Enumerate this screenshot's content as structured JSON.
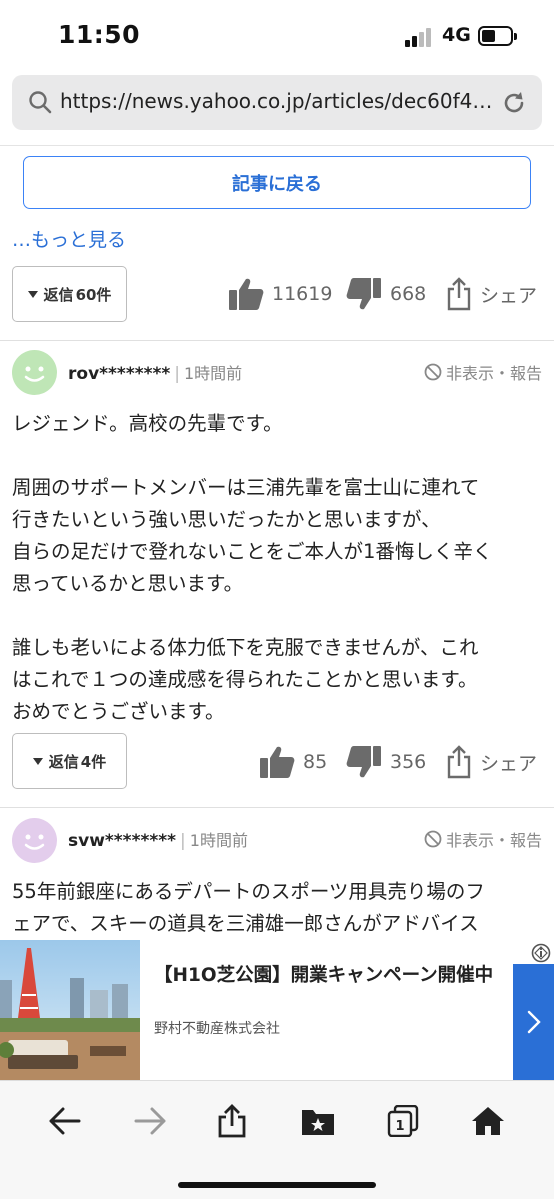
{
  "status_bar": {
    "time": "11:50",
    "network": "4G"
  },
  "browser": {
    "url": "https://news.yahoo.co.jp/articles/dec60f4b..."
  },
  "article": {
    "back_label": "記事に戻る",
    "more_label": "…もっと見る"
  },
  "top_comment": {
    "reply_label": "返信",
    "reply_count": "60件",
    "likes": "11619",
    "dislikes": "668",
    "share_label": "シェア"
  },
  "comments": [
    {
      "user": "rov********",
      "time": "1時間前",
      "hide_report": "非表示・報告",
      "avatar_color": "#bfe6b6",
      "lines": [
        "レジェンド。高校の先輩です。",
        "",
        "周囲のサポートメンバーは三浦先輩を富士山に連れて",
        "行きたいという強い思いだったかと思いますが、",
        "自らの足だけで登れないことをご本人が1番悔しく辛く",
        "思っているかと思います。",
        "",
        "誰しも老いによる体力低下を克服できませんが、これ",
        "はこれで１つの達成感を得られたことかと思います。",
        "おめでとうございます。"
      ],
      "reply_label": "返信",
      "reply_count": "4件",
      "likes": "85",
      "dislikes": "356",
      "share_label": "シェア"
    },
    {
      "user": "svw********",
      "time": "1時間前",
      "hide_report": "非表示・報告",
      "avatar_color": "#e3cdec",
      "lines": [
        "55年前銀座にあるデパートのスポーツ用具売り場のフ",
        "ェアで、スキーの道具を三浦雄一郎さんがアドバイス"
      ]
    }
  ],
  "ad": {
    "title": "【H1O芝公園】開業キャンペーン開催中",
    "sponsor": "野村不動産株式会社"
  },
  "toolbar": {
    "tabs_count": "1"
  },
  "colors": {
    "accent": "#2a6fd6",
    "text": "#222222",
    "muted": "#888888"
  }
}
